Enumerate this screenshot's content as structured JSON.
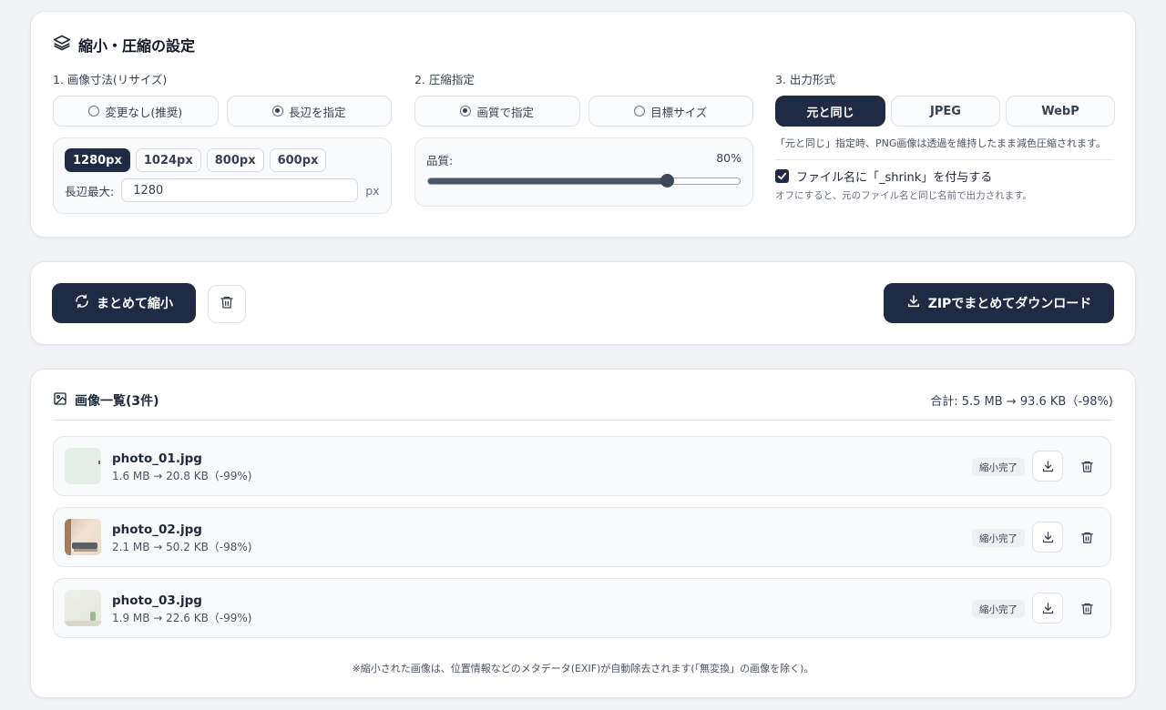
{
  "settings": {
    "title": "縮小・圧縮の設定",
    "resize": {
      "label": "1. 画像寸法(リサイズ)",
      "options": [
        "変更なし(推奨)",
        "長辺を指定"
      ],
      "selected": 1,
      "presets": [
        "1280px",
        "1024px",
        "800px",
        "600px"
      ],
      "active_preset": 0,
      "max_label": "長辺最大:",
      "max_value": "1280",
      "unit": "px"
    },
    "compress": {
      "label": "2. 圧縮指定",
      "options": [
        "画質で指定",
        "目標サイズ"
      ],
      "selected": 0,
      "quality_label": "品質:",
      "quality_value": "80%",
      "quality_fraction": 0.765
    },
    "output": {
      "label": "3. 出力形式",
      "formats": [
        "元と同じ",
        "JPEG",
        "WebP"
      ],
      "active": 0,
      "note": "「元と同じ」指定時、PNG画像は透過を維持したまま減色圧縮されます。",
      "checkbox_label": "ファイル名に「_shrink」を付与する",
      "checkbox_checked": true,
      "checkbox_note": "オフにすると、元のファイル名と同じ名前で出力されます。"
    }
  },
  "actions": {
    "shrink_all": "まとめて縮小",
    "zip_download": "ZIPでまとめてダウンロード"
  },
  "list": {
    "title": "画像一覧(3件)",
    "total_label": "合計:",
    "total_value": "5.5 MB → 93.6 KB（-98%)",
    "status_label": "縮小完了",
    "items": [
      {
        "name": "photo_01.jpg",
        "size": "1.6 MB → 20.8 KB（-99%)"
      },
      {
        "name": "photo_02.jpg",
        "size": "2.1 MB → 50.2 KB（-98%)"
      },
      {
        "name": "photo_03.jpg",
        "size": "1.9 MB → 22.6 KB（-99%)"
      }
    ],
    "footnote": "※縮小された画像は、位置情報などのメタデータ(EXIF)が自動除去されます(「無変換」の画像を除く)。"
  },
  "colors": {
    "accent": "#1f2a44",
    "background": "#f1f3f6"
  }
}
